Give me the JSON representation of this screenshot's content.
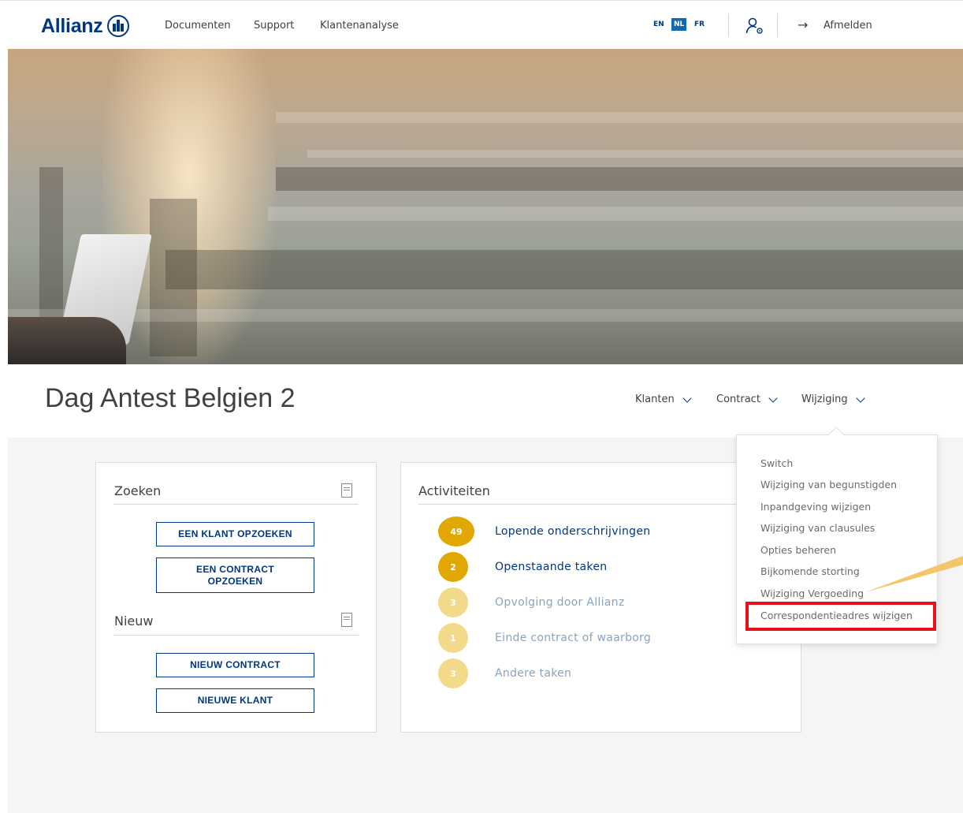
{
  "header": {
    "brand": "Allianz",
    "nav": [
      "Documenten",
      "Support",
      "Klantenanalyse"
    ],
    "languages": [
      "EN",
      "NL",
      "FR"
    ],
    "active_language": "NL",
    "logout_label": "Afmelden"
  },
  "page": {
    "title": "Dag Antest Belgien 2",
    "menus": [
      "Klanten",
      "Contract",
      "Wijziging"
    ]
  },
  "search_card": {
    "title": "Zoeken",
    "find_client_button": "EEN KLANT OPZOEKEN",
    "find_contract_button": "EEN CONTRACT OPZOEKEN",
    "new_section_title": "Nieuw",
    "new_contract_button": "NIEUW CONTRACT",
    "new_client_button": "NIEUWE KLANT"
  },
  "activities_card": {
    "title": "Activiteiten",
    "items": [
      {
        "count": "49",
        "label": "Lopende onderschrijvingen"
      },
      {
        "count": "2",
        "label": "Openstaande taken"
      },
      {
        "count": "3",
        "label": "Opvolging door Allianz"
      },
      {
        "count": "1",
        "label": "Einde contract of waarborg"
      },
      {
        "count": "3",
        "label": "Andere taken"
      }
    ]
  },
  "wijziging_dropdown": {
    "items": [
      "Switch",
      "Wijziging van begunstigden",
      "Inpandgeving wijzigen",
      "Wijziging van clausules",
      "Opties beheren",
      "Bijkomende storting",
      "Wijziging Vergoeding",
      "Correspondentieadres wijzigen"
    ],
    "highlighted_item": "Correspondentieadres wijzigen"
  },
  "colors": {
    "brand_blue": "#003781",
    "active_lang_bg": "#0e6bb0",
    "badge_dark": "#e0a800",
    "badge_light": "#f3d98a",
    "highlight_red": "#e8101c",
    "pointer_yellow": "#f4c66a"
  }
}
